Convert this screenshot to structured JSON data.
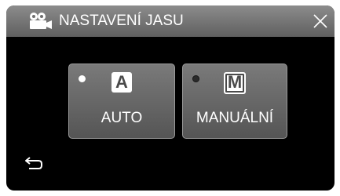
{
  "header": {
    "title": "NASTAVENÍ JASU",
    "mode_icon": "movie-camera-icon",
    "close_icon": "close-icon"
  },
  "options": [
    {
      "badge": "A",
      "label": "AUTO",
      "selected": true
    },
    {
      "badge": "M",
      "label": "MANUÁLNÍ",
      "selected": false
    }
  ],
  "footer": {
    "back_icon": "return-arrow-icon"
  },
  "colors": {
    "header_top": "#8c8c8c",
    "header_bottom": "#5f5f5f",
    "button_top": "#7a7a7a",
    "button_bottom": "#555555",
    "background": "#000000",
    "text": "#ffffff"
  }
}
